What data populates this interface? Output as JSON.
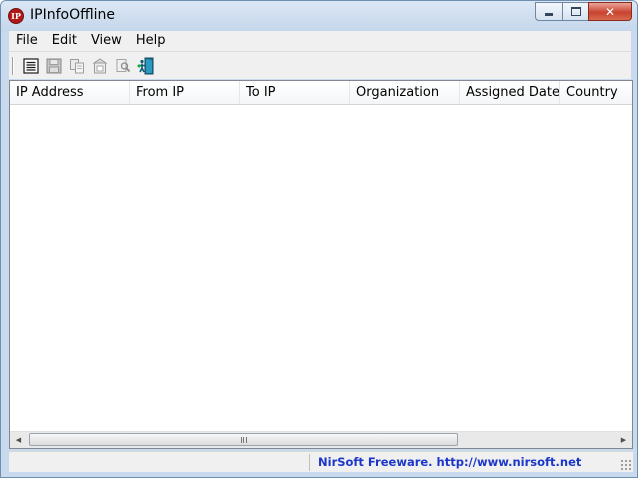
{
  "window": {
    "title": "IPInfoOffline",
    "app_icon_text": "IP",
    "caption_buttons": [
      "minimize-button",
      "maximize-button",
      "close-button"
    ]
  },
  "menu": [
    "File",
    "Edit",
    "View",
    "Help"
  ],
  "toolbar": {
    "buttons": [
      {
        "name": "properties-icon"
      },
      {
        "name": "save-icon"
      },
      {
        "name": "copy-icon"
      },
      {
        "name": "html-report-icon"
      },
      {
        "name": "find-icon"
      },
      {
        "name": "exit-icon"
      }
    ]
  },
  "list": {
    "columns": [
      "IP Address",
      "From IP",
      "To IP",
      "Organization",
      "Assigned Date",
      "Country"
    ],
    "rows": []
  },
  "status": {
    "link_text": "NirSoft Freeware.  http://www.nirsoft.net"
  },
  "colors": {
    "title_bar": "#c9daee",
    "close_button": "#c9432f",
    "status_link": "#1b36c8"
  }
}
